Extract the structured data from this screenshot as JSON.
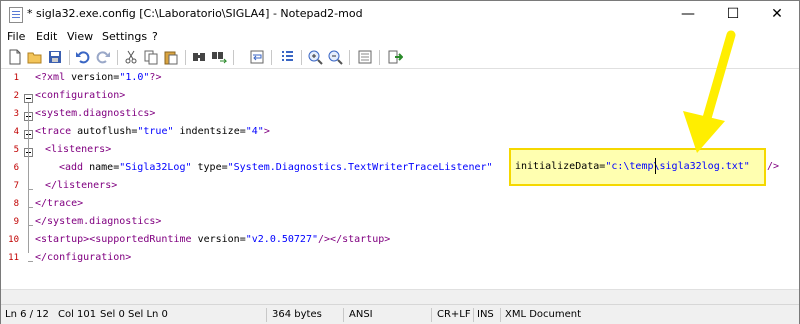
{
  "window": {
    "title": "* sigla32.exe.config [C:\\Laboratorio\\SIGLA4] - Notepad2-mod",
    "minimize": "—",
    "maximize": "☐",
    "close": "✕"
  },
  "menu": [
    "File",
    "Edit",
    "View",
    "Settings",
    "?"
  ],
  "toolbar": [
    "new-icon",
    "open-icon",
    "save-icon",
    "undo-icon",
    "redo-icon",
    "cut-icon",
    "copy-icon",
    "paste-icon",
    "find-icon",
    "replace-icon",
    "wordwrap-icon",
    "view-whitespace-icon",
    "zoom-in-icon",
    "zoom-out-icon",
    "scheme-icon",
    "exit-icon"
  ],
  "lines": {
    "n1": "1",
    "n2": "2",
    "n3": "3",
    "n4": "4",
    "n5": "5",
    "n6": "6",
    "n7": "7",
    "n8": "8",
    "n9": "9",
    "n10": "10",
    "n11": "11",
    "l1_a": "<?xml ",
    "l1_b": "version",
    "l1_c": "=",
    "l1_d": "\"1.0\"",
    "l1_e": "?>",
    "l2": "<configuration>",
    "l3": "<system.diagnostics>",
    "l4_a": "<trace ",
    "l4_b": "autoflush",
    "l4_c": "=",
    "l4_d": "\"true\"",
    "l4_e": " indentsize",
    "l4_f": "=",
    "l4_g": "\"4\"",
    "l4_h": ">",
    "l5": "<listeners>",
    "l6_a": "<add ",
    "l6_b": "name",
    "l6_c": "=",
    "l6_d": "\"Sigla32Log\"",
    "l6_e": " type",
    "l6_f": "=",
    "l6_g": "\"System.Diagnostics.TextWriterTraceListener\"",
    "l6_h": "initializeData",
    "l6_i": "=",
    "l6_j": "\"c:\\temp\\sigla32log.txt\"",
    "l6_k": "/>",
    "l7": "</listeners>",
    "l8": "</trace>",
    "l9": "</system.diagnostics>",
    "l10_a": "<startup>",
    "l10_b": "<supportedRuntime ",
    "l10_c": "version",
    "l10_d": "=",
    "l10_e": "\"v2.0.50727\"",
    "l10_f": "/>",
    "l10_g": "</startup>",
    "l11": "</configuration>"
  },
  "status": {
    "ln": "Ln 6 / 12",
    "col": "Col 101",
    "sel": "Sel 0",
    "selln": "Sel Ln 0",
    "size": "364 bytes",
    "encoding": "ANSI",
    "eol": "CR+LF",
    "ins": "INS",
    "scheme": "XML Document"
  },
  "colors": {
    "highlight_fill": "#ffffb0",
    "highlight_border": "#f5d800",
    "arrow": "#ffee00",
    "tag": "#800080",
    "string": "#0000ff",
    "line_number": "#c00000"
  }
}
